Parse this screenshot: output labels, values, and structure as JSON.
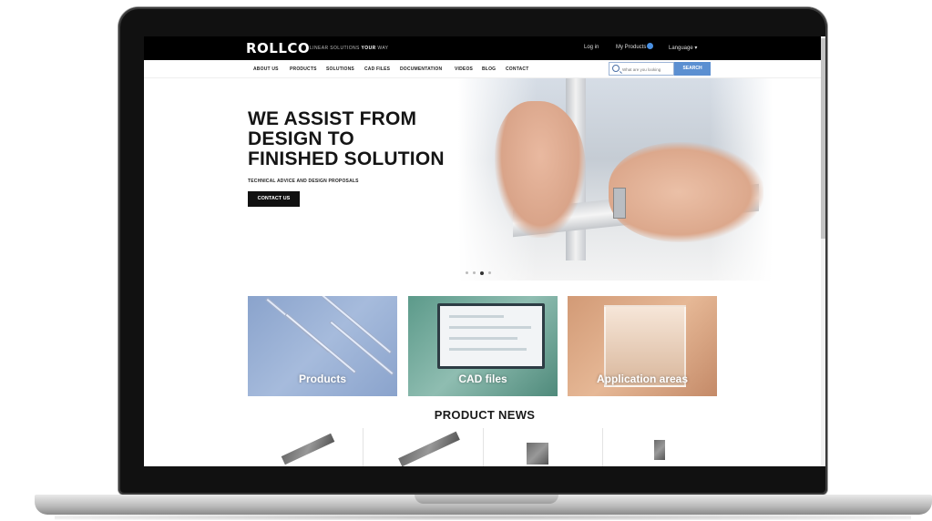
{
  "header": {
    "logo": "ROLLCO",
    "tagline_pre": "LINEAR SOLUTIONS ",
    "tagline_bold": "YOUR",
    "tagline_post": " WAY",
    "login": "Log in",
    "my_products": "My Products",
    "language": "Language ▾"
  },
  "nav": {
    "items": [
      "ABOUT US",
      "PRODUCTS",
      "SOLUTIONS",
      "CAD FILES",
      "DOCUMENTATION",
      "VIDEOS",
      "BLOG",
      "CONTACT"
    ],
    "search_placeholder": "What are you looking",
    "search_button": "SEARCH"
  },
  "hero": {
    "title": "WE ASSIST FROM\nDESIGN TO\nFINISHED SOLUTION",
    "subtitle": "TECHNICAL ADVICE AND DESIGN PROPOSALS",
    "button": "CONTACT US",
    "slides": 4,
    "active_slide": 3
  },
  "tiles": [
    {
      "label": "Products",
      "color": "#8aa3cc"
    },
    {
      "label": "CAD files",
      "color": "#5c9a8a"
    },
    {
      "label": "Application areas",
      "color": "#d29a76"
    }
  ],
  "news": {
    "title": "PRODUCT NEWS"
  },
  "colors": {
    "accent": "#5b8fd1",
    "topbar": "#000000",
    "badge": "#4a90e2"
  }
}
